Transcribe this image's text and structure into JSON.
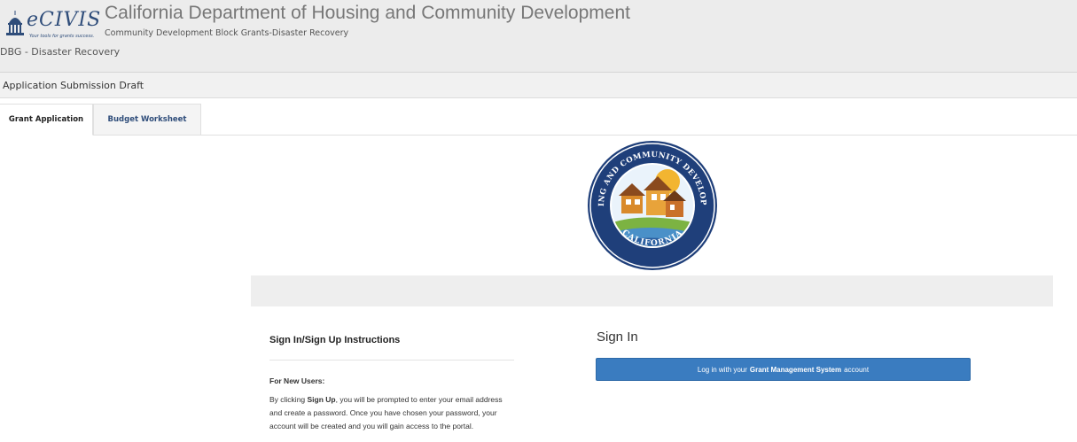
{
  "header": {
    "logo_text": "eCIVIS",
    "logo_tagline": "Your tools for grants success.",
    "app_title": "California Department of Housing and Community Development",
    "app_subtitle": "Community Development Block Grants-Disaster Recovery",
    "program_label": "DBG - Disaster Recovery"
  },
  "draft_bar": {
    "title": "Application Submission Draft"
  },
  "tabs": [
    {
      "label": "Grant Application",
      "active": true
    },
    {
      "label": "Budget Worksheet",
      "active": false
    }
  ],
  "seal": {
    "ring_text_top": "HOUSING AND COMMUNITY DEVELOPMENT",
    "ring_text_bottom": "CALIFORNIA",
    "colors": {
      "ring": "#1f3f7a",
      "sun": "#f2b531",
      "green": "#7cb342",
      "water": "#4a90c8"
    }
  },
  "instructions": {
    "title": "Sign In/Sign Up Instructions",
    "new_users_label": "For New Users:",
    "body_prefix": "By clicking ",
    "body_emphasis": "Sign Up",
    "body_suffix": ", you will be prompted to enter your email address and create a password. Once you have chosen your password, your account will be created and you will gain access to the portal."
  },
  "signin": {
    "heading": "Sign In",
    "button_prefix": "Log in with your",
    "button_emphasis": "Grant Management System",
    "button_suffix": "account"
  },
  "colors": {
    "primary_button": "#3a7cc0",
    "header_bg": "#ececec",
    "brand": "#2f4d7a"
  }
}
